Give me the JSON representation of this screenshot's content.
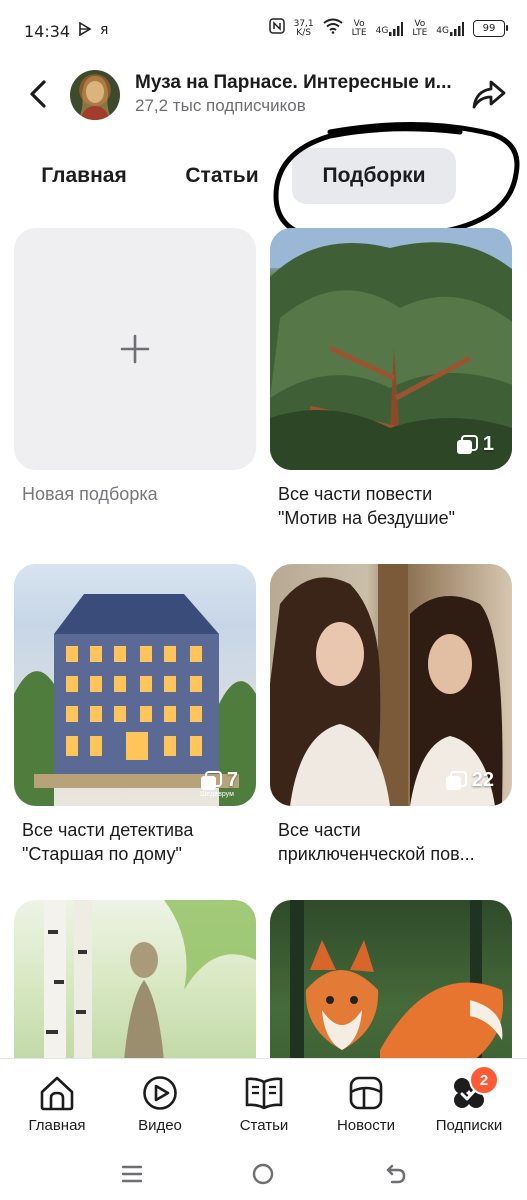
{
  "status_bar": {
    "time": "14:34",
    "app_icons": [
      "play-icon",
      "yandex-icon"
    ],
    "net_speed_value": "37,1",
    "net_speed_unit": "K/S",
    "network1": "Vo\nLTE",
    "network2_type": "4G",
    "network3": "Vo\nLTE",
    "network4_type": "4G",
    "battery": "99"
  },
  "header": {
    "title": "Муза на Парнасе. Интересные и...",
    "subscribers": "27,2 тыс подписчиков"
  },
  "tabs": [
    {
      "label": "Главная",
      "active": false
    },
    {
      "label": "Статьи",
      "active": false
    },
    {
      "label": "Подборки",
      "active": true
    }
  ],
  "collections": [
    {
      "title": "Новая подборка",
      "new": true
    },
    {
      "title": "Все части повести\n\"Мотив на бездушие\"",
      "count": "1"
    },
    {
      "title": "Все части детектива\n\"Старшая по дому\"",
      "count": "7",
      "watermark": "Шедеврум"
    },
    {
      "title": "Все части\nприключенческой пов...",
      "count": "22"
    },
    {
      "title": ""
    },
    {
      "title": ""
    }
  ],
  "bottom_nav": [
    {
      "label": "Главная",
      "icon": "home-icon"
    },
    {
      "label": "Видео",
      "icon": "video-icon"
    },
    {
      "label": "Статьи",
      "icon": "book-icon"
    },
    {
      "label": "Новости",
      "icon": "news-icon"
    },
    {
      "label": "Подписки",
      "icon": "subscriptions-icon",
      "badge": "2"
    }
  ],
  "colors": {
    "active_tab_bg": "#e8e9ec",
    "badge": "#ff5a36",
    "muted_text": "#6f6f73"
  }
}
